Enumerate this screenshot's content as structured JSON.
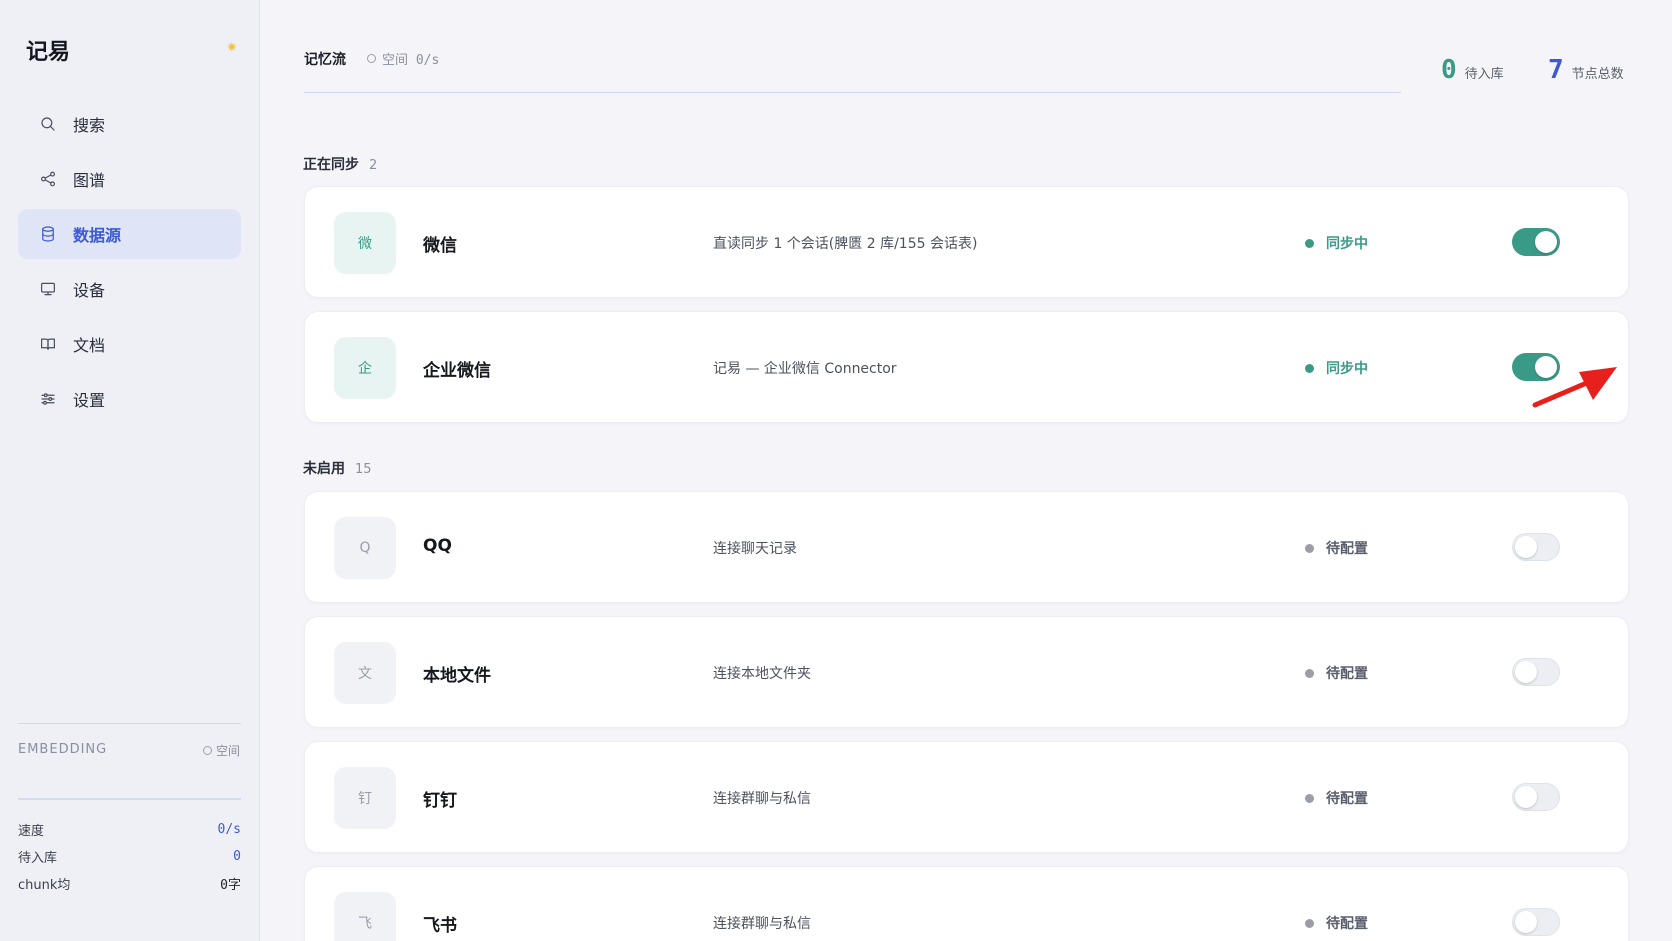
{
  "sidebar": {
    "brand": "记易",
    "items": [
      {
        "label": "搜索",
        "icon": "search-icon"
      },
      {
        "label": "图谱",
        "icon": "share-graph-icon"
      },
      {
        "label": "数据源",
        "icon": "database-icon",
        "active": true
      },
      {
        "label": "设备",
        "icon": "monitor-icon"
      },
      {
        "label": "文档",
        "icon": "book-icon"
      },
      {
        "label": "设置",
        "icon": "sliders-icon"
      }
    ],
    "embedding": {
      "label": "EMBEDDING",
      "status": "空间",
      "stats": [
        {
          "label": "速度",
          "value": "0/s"
        },
        {
          "label": "待入库",
          "value": "0"
        },
        {
          "label": "chunk均",
          "value": "0字"
        }
      ]
    }
  },
  "header": {
    "tab": "记忆流",
    "meta": "空间 0/s",
    "kpis": [
      {
        "value": "0",
        "label": "待入库",
        "color": "#3a9a88"
      },
      {
        "value": "7",
        "label": "节点总数",
        "color": "#3b5bd6"
      }
    ]
  },
  "sections": {
    "syncing": {
      "title": "正在同步",
      "count": "2"
    },
    "disabled": {
      "title": "未启用",
      "count": "15"
    }
  },
  "sources": [
    {
      "badge": "微",
      "name": "微信",
      "desc": "直读同步 1 个会话(脾匮 2 库/155 会话表)",
      "status": "同步中",
      "enabled": true
    },
    {
      "badge": "企",
      "name": "企业微信",
      "desc": "记易 — 企业微信 Connector",
      "status": "同步中",
      "enabled": true
    },
    {
      "badge": "Q",
      "name": "QQ",
      "desc": "连接聊天记录",
      "status": "待配置",
      "enabled": false
    },
    {
      "badge": "文",
      "name": "本地文件",
      "desc": "连接本地文件夹",
      "status": "待配置",
      "enabled": false
    },
    {
      "badge": "钉",
      "name": "钉钉",
      "desc": "连接群聊与私信",
      "status": "待配置",
      "enabled": false
    },
    {
      "badge": "飞",
      "name": "飞书",
      "desc": "连接群聊与私信",
      "status": "待配置",
      "enabled": false
    }
  ],
  "colors": {
    "accent": "#3b5bd6",
    "green": "#3a9a88",
    "arrow": "#e8201d"
  }
}
